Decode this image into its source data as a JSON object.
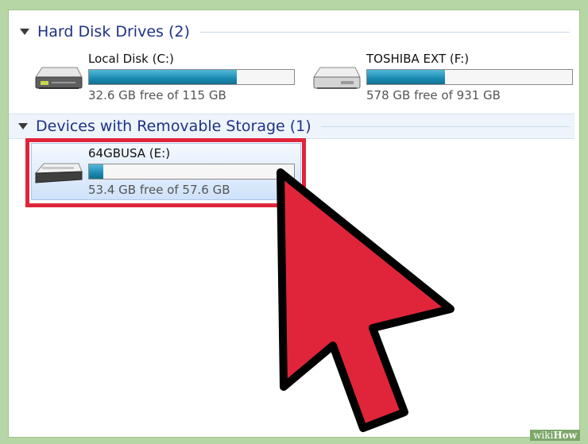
{
  "groups": {
    "hard_disks": {
      "title": "Hard Disk Drives (2)"
    },
    "removable": {
      "title": "Devices with Removable Storage (1)"
    }
  },
  "drives": [
    {
      "name": "Local Disk (C:)",
      "free_text": "32.6 GB free of 115 GB",
      "used_fraction": 0.72
    },
    {
      "name": "TOSHIBA EXT (F:)",
      "free_text": "578 GB free of 931 GB",
      "used_fraction": 0.38
    },
    {
      "name": "64GBUSA (E:)",
      "free_text": "53.4 GB free of 57.6 GB",
      "used_fraction": 0.07
    }
  ],
  "watermark": {
    "prefix": "wiki",
    "suffix": "How"
  },
  "colors": {
    "accent": "#1e3287",
    "highlight": "#e0253b",
    "bar_fill": "#1b8bb3",
    "background": "#b7d6a6"
  }
}
